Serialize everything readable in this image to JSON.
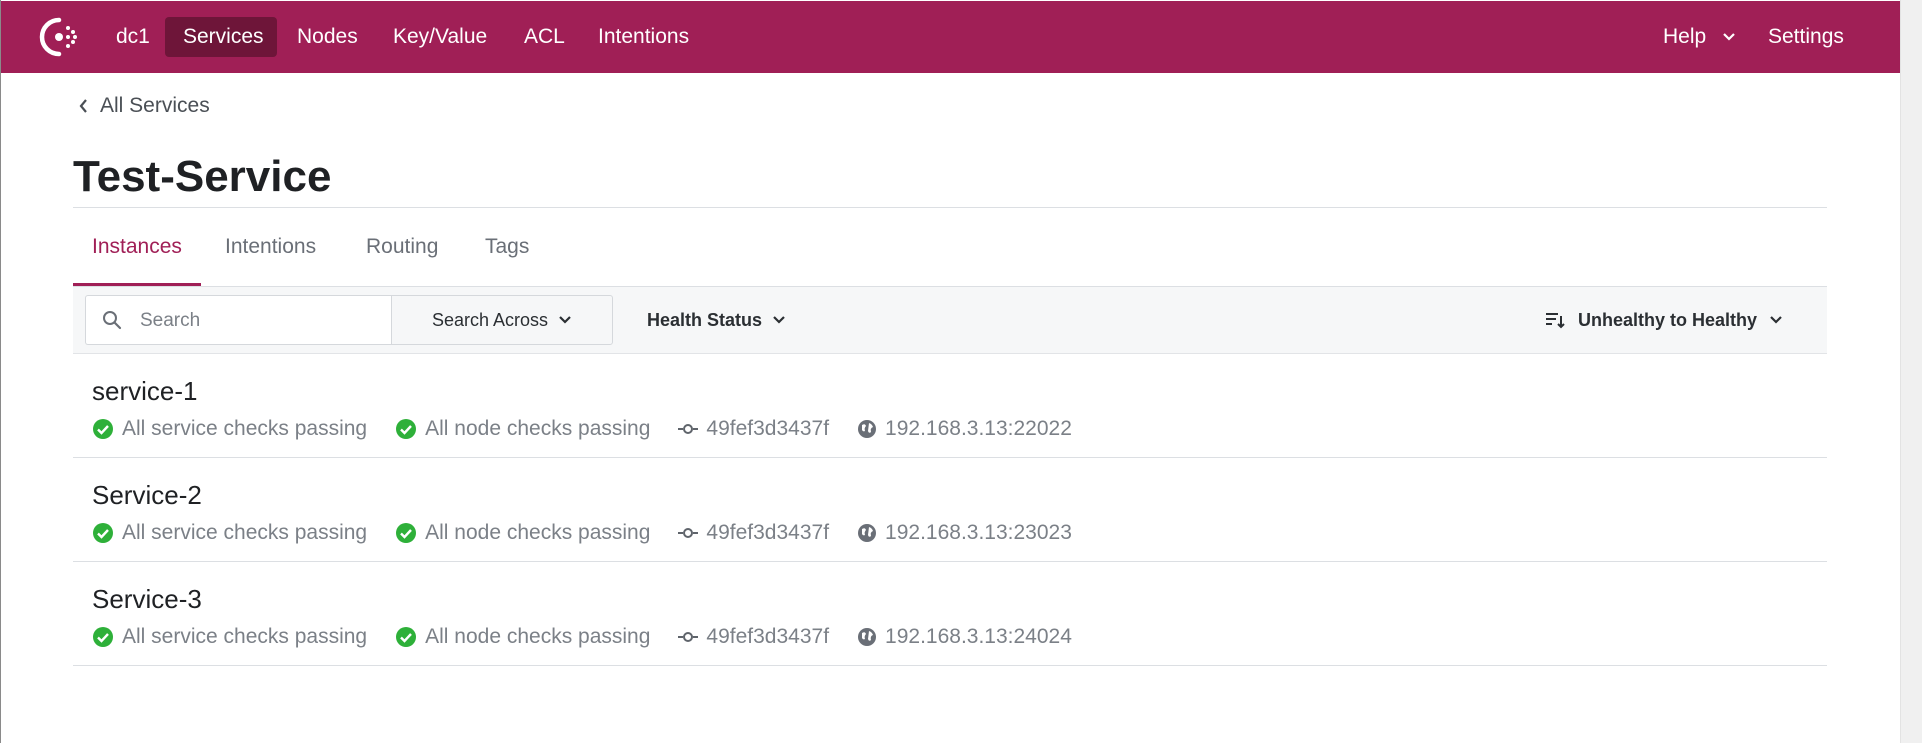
{
  "nav": {
    "datacenter": "dc1",
    "items": [
      {
        "label": "Services",
        "active": true
      },
      {
        "label": "Nodes"
      },
      {
        "label": "Key/Value"
      },
      {
        "label": "ACL"
      },
      {
        "label": "Intentions"
      }
    ],
    "help_label": "Help",
    "settings_label": "Settings",
    "brand_color": "#a01f56"
  },
  "breadcrumb": {
    "label": "All Services"
  },
  "page": {
    "title": "Test-Service"
  },
  "tabs": [
    {
      "label": "Instances",
      "active": true
    },
    {
      "label": "Intentions"
    },
    {
      "label": "Routing"
    },
    {
      "label": "Tags"
    }
  ],
  "toolbar": {
    "search_placeholder": "Search",
    "search_across_label": "Search Across",
    "health_status_label": "Health Status",
    "sort_label": "Unhealthy to Healthy"
  },
  "instances": [
    {
      "name": "service-1",
      "service_checks": "All service checks passing",
      "node_checks": "All node checks passing",
      "node": "49fef3d3437f",
      "address": "192.168.3.13:22022"
    },
    {
      "name": "Service-2",
      "service_checks": "All service checks passing",
      "node_checks": "All node checks passing",
      "node": "49fef3d3437f",
      "address": "192.168.3.13:23023"
    },
    {
      "name": "Service-3",
      "service_checks": "All service checks passing",
      "node_checks": "All node checks passing",
      "node": "49fef3d3437f",
      "address": "192.168.3.13:24024"
    }
  ],
  "colors": {
    "passing": "#2eb039",
    "tab_active": "#a01f56"
  }
}
